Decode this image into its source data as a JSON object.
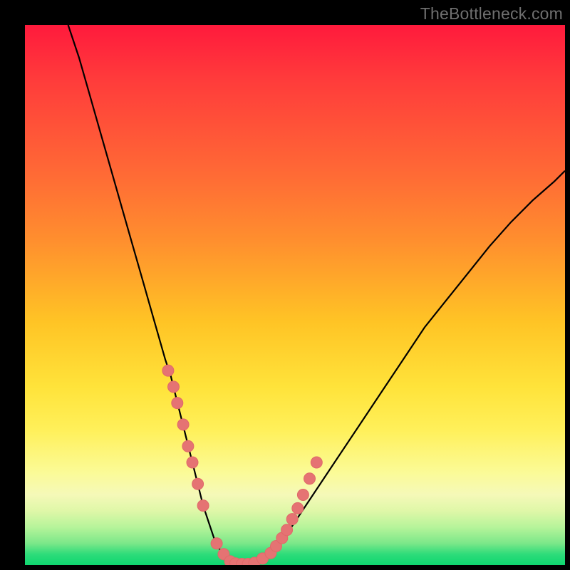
{
  "watermark": "TheBottleneck.com",
  "colors": {
    "frame": "#000000",
    "curve": "#000000",
    "dot_fill": "#e57373",
    "dot_stroke": "#e06969"
  },
  "chart_data": {
    "type": "line",
    "title": "",
    "xlabel": "",
    "ylabel": "",
    "xlim": [
      0,
      100
    ],
    "ylim": [
      0,
      100
    ],
    "x": [
      8,
      10,
      12,
      14,
      16,
      18,
      20,
      22,
      24,
      26,
      27,
      28,
      29,
      30,
      31,
      32,
      33,
      34,
      35,
      36,
      37,
      38,
      39,
      40,
      42,
      44,
      46,
      48,
      50,
      54,
      58,
      62,
      66,
      70,
      74,
      78,
      82,
      86,
      90,
      94,
      98,
      100
    ],
    "values": [
      100,
      94,
      87,
      80,
      73,
      66,
      59,
      52,
      45,
      38,
      35,
      31,
      27,
      23,
      19,
      15,
      11,
      8,
      5,
      3,
      1.5,
      0.7,
      0.3,
      0.2,
      0.4,
      1,
      2.5,
      5,
      8,
      14,
      20,
      26,
      32,
      38,
      44,
      49,
      54,
      59,
      63.5,
      67.5,
      71,
      73
    ],
    "series": [
      {
        "name": "scatter-dots",
        "x": [
          26.5,
          27.5,
          28.2,
          29.3,
          30.2,
          31.0,
          32.0,
          33.0,
          35.5,
          36.8,
          38.0,
          39.0,
          40.2,
          41.3,
          42.5,
          44.0,
          45.5,
          46.5,
          47.6,
          48.5,
          49.5,
          50.5,
          51.5,
          52.7,
          54.0
        ],
        "values": [
          36,
          33,
          30,
          26,
          22,
          19,
          15,
          11,
          4,
          2,
          0.7,
          0.3,
          0.2,
          0.2,
          0.4,
          1.2,
          2.2,
          3.5,
          5.0,
          6.5,
          8.5,
          10.5,
          13,
          16,
          19
        ]
      }
    ]
  }
}
